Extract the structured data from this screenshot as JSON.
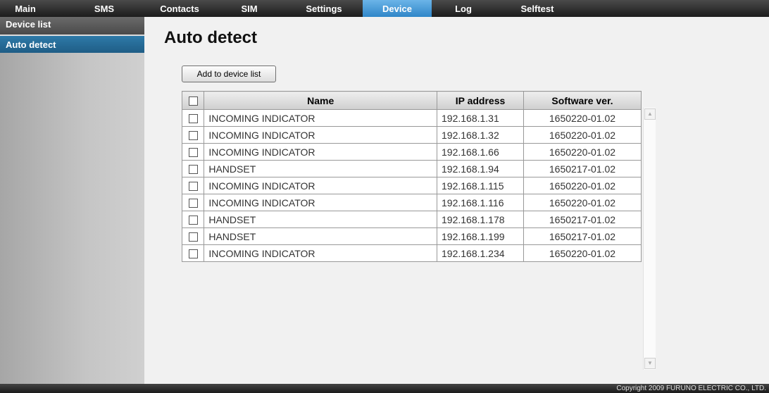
{
  "nav": {
    "items": [
      {
        "label": "Main",
        "active": false
      },
      {
        "label": "SMS",
        "active": false
      },
      {
        "label": "Contacts",
        "active": false
      },
      {
        "label": "SIM",
        "active": false
      },
      {
        "label": "Settings",
        "active": false
      },
      {
        "label": "Device",
        "active": true
      },
      {
        "label": "Log",
        "active": false
      },
      {
        "label": "Selftest",
        "active": false
      }
    ]
  },
  "sidebar": {
    "items": [
      {
        "label": "Device list",
        "selected": false
      },
      {
        "label": "Auto detect",
        "selected": true
      }
    ]
  },
  "page": {
    "title": "Auto detect",
    "add_button_label": "Add to device list"
  },
  "table": {
    "headers": {
      "name": "Name",
      "ip": "IP address",
      "software": "Software ver."
    },
    "rows": [
      {
        "name": "INCOMING INDICATOR",
        "ip": "192.168.1.31",
        "software": "1650220-01.02"
      },
      {
        "name": "INCOMING INDICATOR",
        "ip": "192.168.1.32",
        "software": "1650220-01.02"
      },
      {
        "name": "INCOMING INDICATOR",
        "ip": "192.168.1.66",
        "software": "1650220-01.02"
      },
      {
        "name": "HANDSET",
        "ip": "192.168.1.94",
        "software": "1650217-01.02"
      },
      {
        "name": "INCOMING INDICATOR",
        "ip": "192.168.1.115",
        "software": "1650220-01.02"
      },
      {
        "name": "INCOMING INDICATOR",
        "ip": "192.168.1.116",
        "software": "1650220-01.02"
      },
      {
        "name": "HANDSET",
        "ip": "192.168.1.178",
        "software": "1650217-01.02"
      },
      {
        "name": "HANDSET",
        "ip": "192.168.1.199",
        "software": "1650217-01.02"
      },
      {
        "name": "INCOMING INDICATOR",
        "ip": "192.168.1.234",
        "software": "1650220-01.02"
      }
    ]
  },
  "footer": {
    "copyright": "Copyright 2009 FURUNO ELECTRIC CO., LTD."
  },
  "colors": {
    "nav_active": "#2f86c8",
    "sidebar_selected": "#1f5d86",
    "nav_bar": "#1c1c1c"
  }
}
